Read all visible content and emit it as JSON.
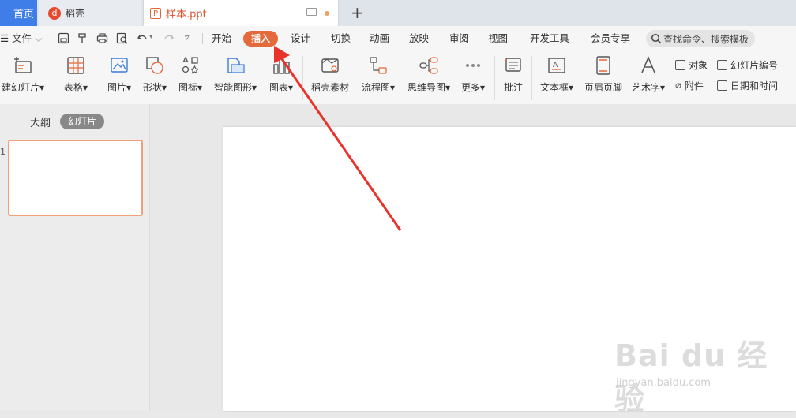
{
  "tabs": {
    "home": "首页",
    "docer": "稻壳",
    "doc": "样本.ppt",
    "add": "+"
  },
  "menu": {
    "file": "☰ 文件",
    "items": [
      "开始",
      "插入",
      "设计",
      "切换",
      "动画",
      "放映",
      "审阅",
      "视图",
      "开发工具",
      "会员专享"
    ],
    "search": "查找命令、搜索模板"
  },
  "ribbon": {
    "new_slide": "建幻灯片",
    "table": "表格",
    "picture": "图片",
    "shape": "形状",
    "icon": "图标",
    "smartart": "智能图形",
    "chart": "图表",
    "docer_material": "稻壳素材",
    "flowchart": "流程图",
    "mindmap": "思维导图",
    "more": "更多",
    "comment": "批注",
    "textbox": "文本框",
    "header_footer": "页眉页脚",
    "wordart": "艺术字",
    "object": "对象",
    "attachment": "附件",
    "slide_number": "幻灯片编号",
    "datetime": "日期和时间"
  },
  "leftpane": {
    "outline": "大纲",
    "slides": "幻灯片",
    "slide_number": "1"
  },
  "watermark": {
    "logo": "Bai du 经验",
    "url": "jingyan.baidu.com"
  },
  "colors": {
    "accent": "#e46a3b",
    "arrow": "#e8322a",
    "home_tab": "#3f7ee8"
  }
}
